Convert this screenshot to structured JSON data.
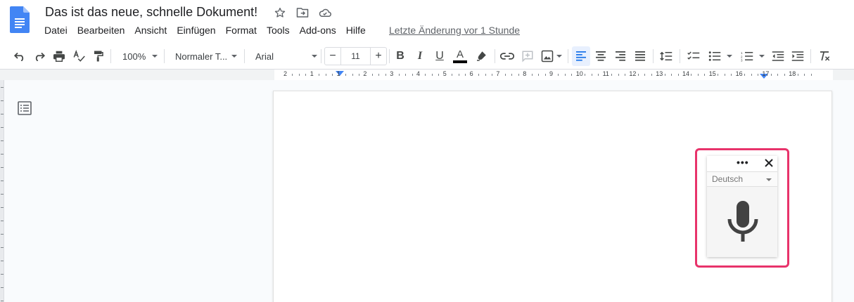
{
  "document": {
    "title": "Das ist das neue, schnelle Dokument!",
    "last_edit": "Letzte Änderung vor 1 Stunde"
  },
  "menu": {
    "items": [
      "Datei",
      "Bearbeiten",
      "Ansicht",
      "Einfügen",
      "Format",
      "Tools",
      "Add-ons",
      "Hilfe"
    ]
  },
  "toolbar": {
    "zoom": "100%",
    "style": "Normaler T...",
    "font": "Arial",
    "font_size": "11",
    "minus": "−",
    "plus": "+"
  },
  "ruler": {
    "numbers": [
      "2",
      "1",
      "1",
      "2",
      "3",
      "4",
      "5",
      "6",
      "7",
      "8",
      "9",
      "10",
      "11",
      "12",
      "13",
      "14",
      "15",
      "16",
      "17",
      "18"
    ]
  },
  "voice_typing": {
    "language": "Deutsch",
    "menu_dots": "•••"
  },
  "colors": {
    "accent": "#4285f4",
    "highlight_frame": "#e8336b",
    "docs_blue": "#4285f4"
  }
}
